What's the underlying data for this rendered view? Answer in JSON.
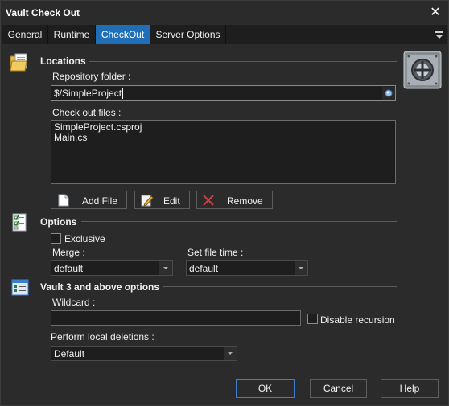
{
  "window": {
    "title": "Vault Check Out",
    "close_glyph": "✕"
  },
  "tabs": [
    {
      "label": "General"
    },
    {
      "label": "Runtime"
    },
    {
      "label": "CheckOut"
    },
    {
      "label": "Server Options"
    }
  ],
  "active_tab": "CheckOut",
  "locations": {
    "title": "Locations",
    "repo_label": "Repository folder :",
    "repo_value": "$/SimpleProject",
    "files_label": "Check out files :",
    "files": [
      "SimpleProject.csproj",
      "Main.cs"
    ],
    "add_label": "Add File",
    "edit_label": "Edit",
    "remove_label": "Remove"
  },
  "options": {
    "title": "Options",
    "exclusive_label": "Exclusive",
    "exclusive_checked": false,
    "merge_label": "Merge :",
    "merge_value": "default",
    "set_file_time_label": "Set file time :",
    "set_file_time_value": "default"
  },
  "vault3": {
    "title": "Vault 3 and above options",
    "wildcard_label": "Wildcard :",
    "wildcard_value": "",
    "disable_recursion_label": "Disable recursion",
    "disable_recursion_checked": false,
    "local_deletions_label": "Perform local deletions :",
    "local_deletions_value": "Default"
  },
  "footer": {
    "ok_label": "OK",
    "cancel_label": "Cancel",
    "help_label": "Help"
  },
  "colors": {
    "background": "#2b2b2b",
    "active_tab": "#1e6fb8",
    "field_bg": "#1e1e1e",
    "remove_x": "#e03c3c",
    "primary_border": "#3a7ed0"
  },
  "icons": [
    "locations-icon",
    "options-icon",
    "vault3-icon",
    "vault-safe-icon",
    "browse-icon",
    "add-file-icon",
    "edit-icon",
    "remove-icon",
    "menu-icon",
    "close-icon"
  ]
}
